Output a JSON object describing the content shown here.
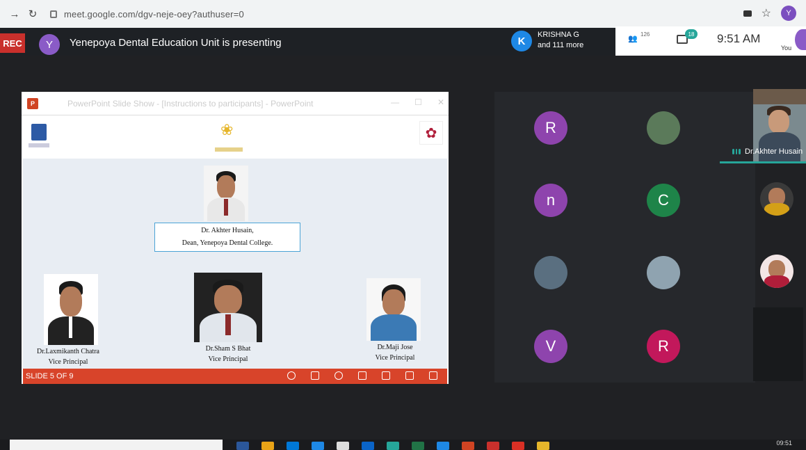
{
  "browser": {
    "back_icon": "arrow-right-icon",
    "reload_icon": "reload-icon",
    "url": "meet.google.com/dgv-neje-oey?authuser=0",
    "profile_initial": "Y"
  },
  "header": {
    "rec_label": "REC",
    "presenter_initial": "Y",
    "presenting_text": "Yenepoya Dental Education Unit is presenting",
    "speaker_initial": "K",
    "speaker_name": "KRISHNA G",
    "speaker_more": "and 111 more",
    "people_count": "126",
    "chat_count": "18",
    "time": "9:51 AM",
    "you_label": "You"
  },
  "presentation": {
    "window_title": "PowerPoint Slide Show - [Instructions to participants] - PowerPoint",
    "dean_name": "Dr. Akhter Husain,",
    "dean_title": "Dean, Yenepoya Dental College.",
    "people": [
      {
        "name": "Dr.Laxmikanth Chatra",
        "role": "Vice Principal"
      },
      {
        "name": "Dr.Sham S Bhat",
        "role": "Vice Principal"
      },
      {
        "name": "Dr.Maji Jose",
        "role": "Vice Principal"
      }
    ],
    "status": "SLIDE 5 OF 9"
  },
  "participants": {
    "tiles": [
      {
        "initial": "R",
        "color": "#8e44ad"
      },
      {
        "initial": "",
        "color": "#5b7a5a"
      },
      {
        "initial": "n",
        "color": "#8e44ad"
      },
      {
        "initial": "C",
        "color": "#1e8449"
      },
      {
        "initial": "",
        "color": "#5a6f80"
      },
      {
        "initial": "",
        "color": "#8fa3b0"
      },
      {
        "initial": "V",
        "color": "#8e44ad"
      },
      {
        "initial": "R",
        "color": "#c2185b"
      }
    ],
    "active_speaker": "Dr.Akhter Husain"
  },
  "taskbar": {
    "time": "09:51"
  }
}
